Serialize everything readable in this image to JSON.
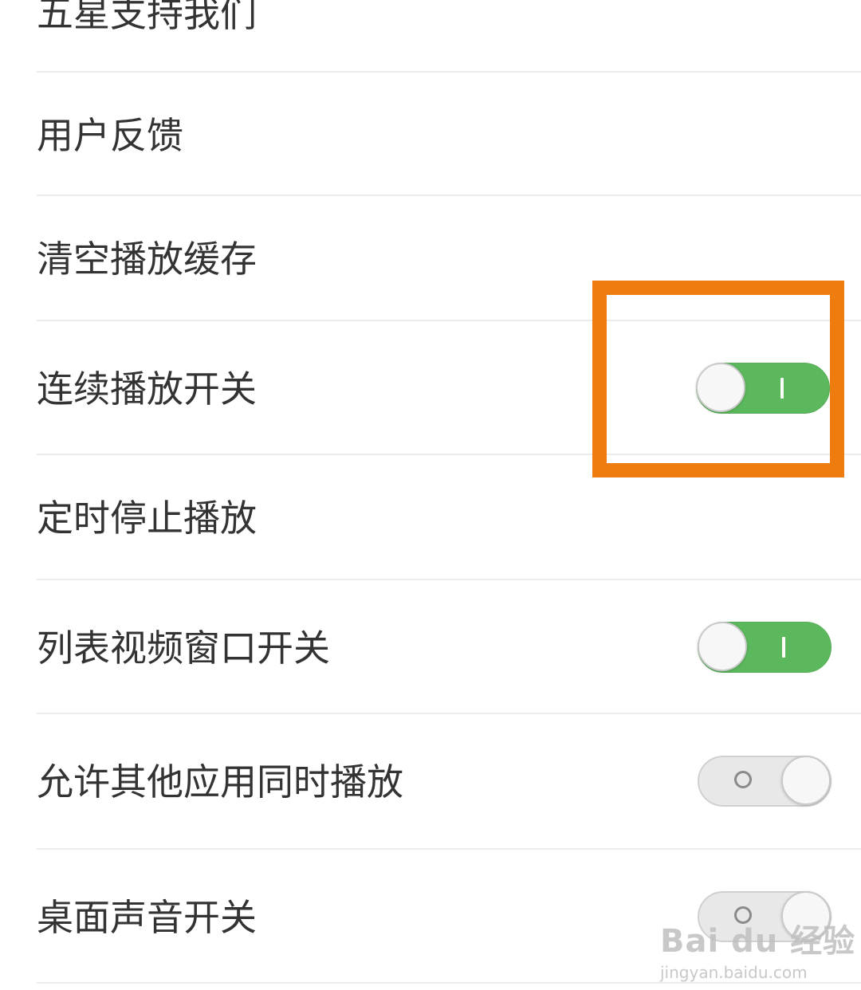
{
  "settings": {
    "items": [
      {
        "label": "五星支持我们"
      },
      {
        "label": "用户反馈"
      },
      {
        "label": "清空播放缓存"
      },
      {
        "label": "连续播放开关",
        "toggle": "on"
      },
      {
        "label": "定时停止播放"
      },
      {
        "label": "列表视频窗口开关",
        "toggle": "on"
      },
      {
        "label": "允许其他应用同时播放",
        "toggle": "off"
      },
      {
        "label": "桌面声音开关",
        "toggle": "off"
      }
    ]
  },
  "colors": {
    "toggle_on": "#5cb85c",
    "toggle_off": "#e8e8e8",
    "highlight": "#ee7c0e",
    "label_text": "#333333"
  },
  "annotation": {
    "highlight_target": "连续播放开关 toggle"
  },
  "watermark": {
    "main": "Bai du 经验",
    "sub": "jingyan.baidu.com"
  }
}
